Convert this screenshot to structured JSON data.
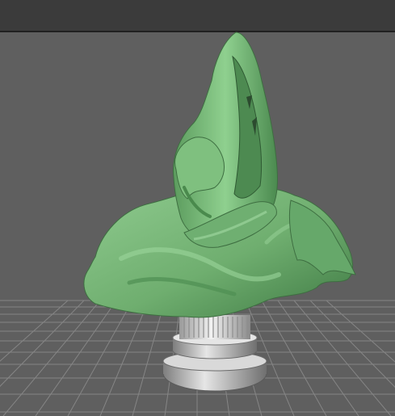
{
  "viewport": {
    "kind": "3d-viewport",
    "background_color": "#5f5f5f",
    "header_strip_color": "#3b3b3b",
    "grid_color": "#8a8a8a"
  },
  "scene": {
    "objects": [
      {
        "id": "bust",
        "material_color": "#78b478"
      },
      {
        "id": "pedestal",
        "material_color": "#cfcfcf"
      }
    ]
  }
}
